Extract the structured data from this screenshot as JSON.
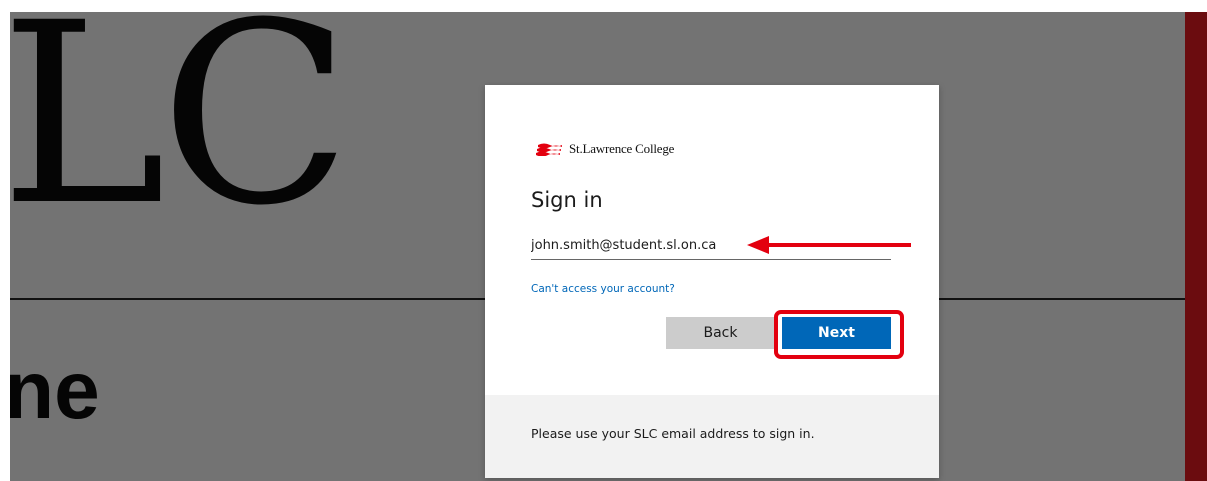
{
  "background": {
    "large_text": "LC",
    "partial_text": "ne"
  },
  "logo": {
    "text": "St.Lawrence College",
    "color": "#e3000f"
  },
  "signin": {
    "title": "Sign in",
    "email_value": "john.smith@student.sl.on.ca",
    "cant_access_link": "Can't access your account?",
    "back_label": "Back",
    "next_label": "Next",
    "footer_text": "Please use your SLC email address to sign in."
  },
  "colors": {
    "primary_button": "#0067b8",
    "annotation_red": "#e3000f",
    "background_gray": "#737373",
    "accent_strip": "#6b0c0f"
  }
}
